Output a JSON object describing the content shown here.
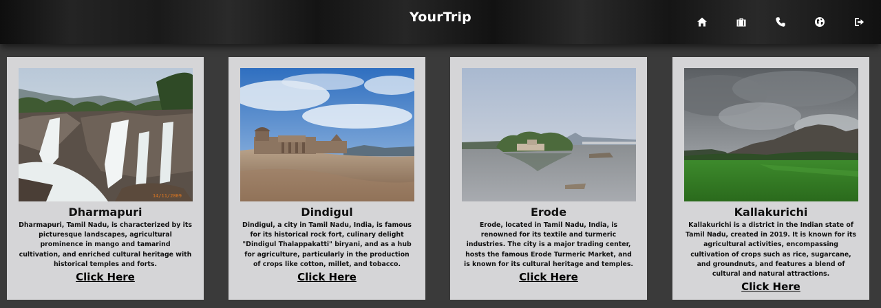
{
  "app": {
    "brand": "YourTrip"
  },
  "nav": {
    "icons": [
      "home-icon",
      "briefcase-icon",
      "phone-icon",
      "globe-icon",
      "logout-icon"
    ]
  },
  "cards": [
    {
      "title": "Dharmapuri",
      "description": "Dharmapuri, Tamil Nadu, is characterized by its picturesque landscapes, agricultural prominence in mango and tamarind cultivation, and enriched cultural heritage with historical temples and forts.",
      "link": "Click Here",
      "photo_stamp": "14/11/2009"
    },
    {
      "title": "Dindigul",
      "description": "Dindigul, a city in Tamil Nadu, India, is famous for its historical rock fort, culinary delight \"Dindigul Thalappakatti\" biryani, and as a hub for agriculture, particularly in the production of crops like cotton, millet, and tobacco.",
      "link": "Click Here"
    },
    {
      "title": "Erode",
      "description": "Erode, located in Tamil Nadu, India, is renowned for its textile and turmeric industries. The city is a major trading center, hosts the famous Erode Turmeric Market, and is known for its cultural heritage and temples.",
      "link": "Click Here"
    },
    {
      "title": "Kallakurichi",
      "description": "Kallakurichi is a district in the Indian state of Tamil Nadu, created in 2019. It is known for its agricultural activities, encompassing cultivation of crops such as rice, sugarcane, and groundnuts, and features a blend of cultural and natural attractions.",
      "link": "Click Here"
    }
  ]
}
